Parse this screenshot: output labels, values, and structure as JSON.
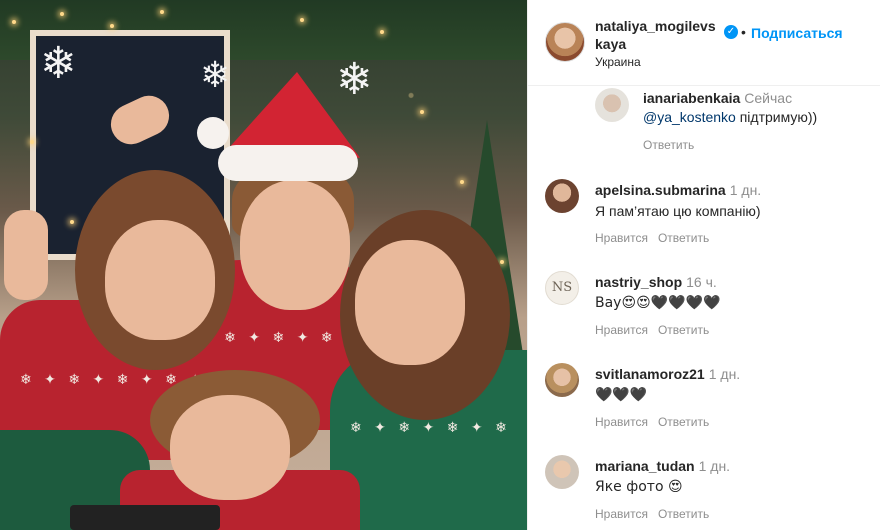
{
  "post": {
    "image_alt": "Group photo of four people in Christmas sweaters",
    "author": {
      "username": "nataliya_mogilevskaya",
      "username_display": "nataliya_mogilevs kaya",
      "verified": true,
      "follow_label": "Подписаться",
      "location": "Украина"
    }
  },
  "icons": {
    "verified": "verified-badge-icon",
    "dot": "•"
  },
  "colors": {
    "accent": "#0095f6",
    "text": "#262626",
    "muted": "#8e8e8e",
    "mention": "#00376b"
  },
  "comments": [
    {
      "username": "ianariabenkaia",
      "time": "Сейчас",
      "mention": "@ya_kostenko",
      "text": "підтримую))",
      "actions": [
        "Ответить"
      ]
    },
    {
      "username": "apelsina.submarina",
      "time": "1 дн.",
      "text": "Я пам’ятаю цю компанію)",
      "actions": [
        "Нравится",
        "Ответить"
      ]
    },
    {
      "username": "nastriy_shop",
      "time": "16 ч.",
      "avatar_text": "NS",
      "text": "Вау😍😍🖤🖤🖤🖤",
      "actions": [
        "Нравится",
        "Ответить"
      ]
    },
    {
      "username": "svitlanamoroz21",
      "time": "1 дн.",
      "text": "🖤🖤🖤",
      "actions": [
        "Нравится",
        "Ответить"
      ]
    },
    {
      "username": "mariana_tudan",
      "time": "1 дн.",
      "text": "Яке фото 😍",
      "actions": [
        "Нравится",
        "Ответить"
      ]
    }
  ]
}
